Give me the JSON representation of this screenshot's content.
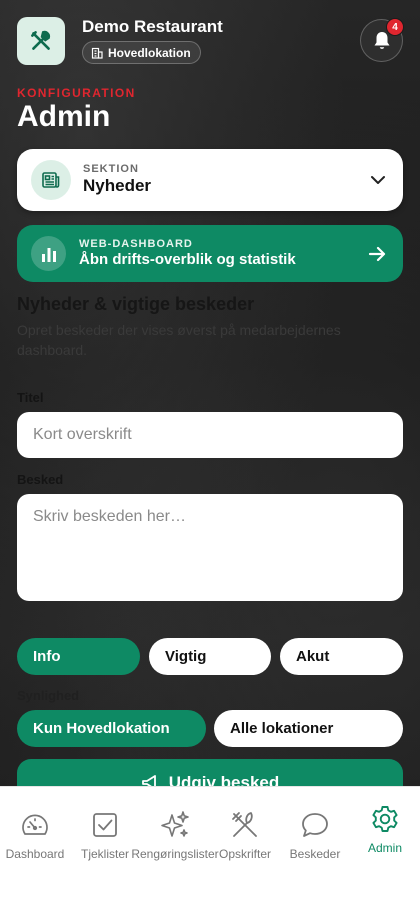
{
  "header": {
    "restaurant_name": "Demo Restaurant",
    "location": "Hovedlokation",
    "notification_count": "4"
  },
  "page": {
    "eyebrow": "KONFIGURATION",
    "title": "Admin"
  },
  "section_select": {
    "eyebrow": "SEKTION",
    "value": "Nyheder"
  },
  "web_dashboard": {
    "eyebrow": "WEB-DASHBOARD",
    "title": "Åbn drifts-overblik og statistik"
  },
  "form": {
    "heading": "Nyheder & vigtige beskeder",
    "description": "Opret beskeder der vises øverst på medarbejdernes dashboard.",
    "title_label": "Titel",
    "title_placeholder": "Kort overskrift",
    "message_label": "Besked",
    "message_placeholder": "Skriv beskeden her…",
    "priority_options": [
      "Info",
      "Vigtig",
      "Akut"
    ],
    "priority_selected": "Info",
    "location_label": "Synlighed",
    "location_options": [
      "Kun Hovedlokation",
      "Alle lokationer"
    ],
    "location_selected": "Kun Hovedlokation",
    "publish_label": "Udgiv besked"
  },
  "tabbar": {
    "items": [
      {
        "label": "Dashboard",
        "icon": "gauge-icon"
      },
      {
        "label": "Tjeklister",
        "icon": "checkbox-icon"
      },
      {
        "label": "Rengøringslister",
        "icon": "sparkles-icon"
      },
      {
        "label": "Opskrifter",
        "icon": "utensils-icon"
      },
      {
        "label": "Beskeder",
        "icon": "chat-bubble-icon"
      },
      {
        "label": "Admin",
        "icon": "gear-icon"
      }
    ],
    "active": "Admin"
  },
  "colors": {
    "accent": "#0e8a64",
    "danger": "#e0262f",
    "accent_light": "#dcefe6"
  }
}
